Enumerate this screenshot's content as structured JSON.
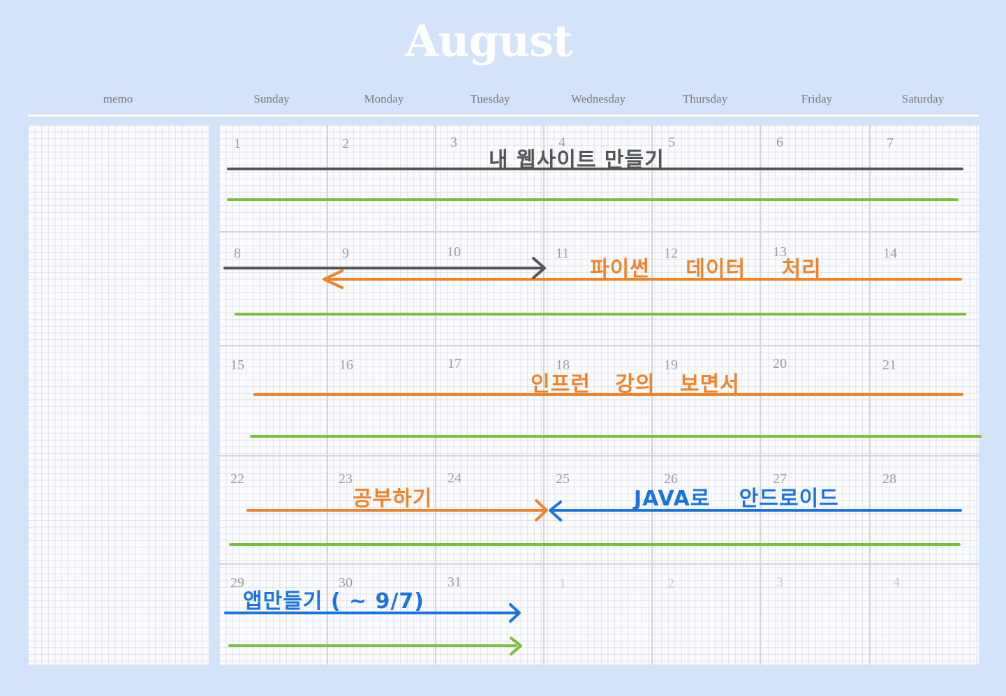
{
  "title": "August",
  "columns": {
    "memo": "memo",
    "days": [
      "Sunday",
      "Monday",
      "Tuesday",
      "Wednesday",
      "Thursday",
      "Friday",
      "Saturday"
    ]
  },
  "weeks": [
    [
      "1",
      "2",
      "3",
      "4",
      "5",
      "6",
      "7"
    ],
    [
      "8",
      "9",
      "10",
      "11",
      "12",
      "13",
      "14"
    ],
    [
      "15",
      "16",
      "17",
      "18",
      "19",
      "20",
      "21"
    ],
    [
      "22",
      "23",
      "24",
      "25",
      "26",
      "27",
      "28"
    ],
    [
      "29",
      "30",
      "31",
      "1",
      "2",
      "3",
      "4"
    ]
  ],
  "events": {
    "website": "내 웹사이트 만들기",
    "python": "파이썬 데이터 처리",
    "inflearn": "인프런 강의 보면서",
    "study": "공부하기",
    "java": "JAVA로 안드로이드",
    "app": "앱만들기 ( ~ 9/7)"
  },
  "colors": {
    "background": "#d3e4fa",
    "gray_line": "#555555",
    "green_line": "#7bbf3f",
    "orange_line": "#f0832a",
    "blue_line": "#1a73e0"
  }
}
